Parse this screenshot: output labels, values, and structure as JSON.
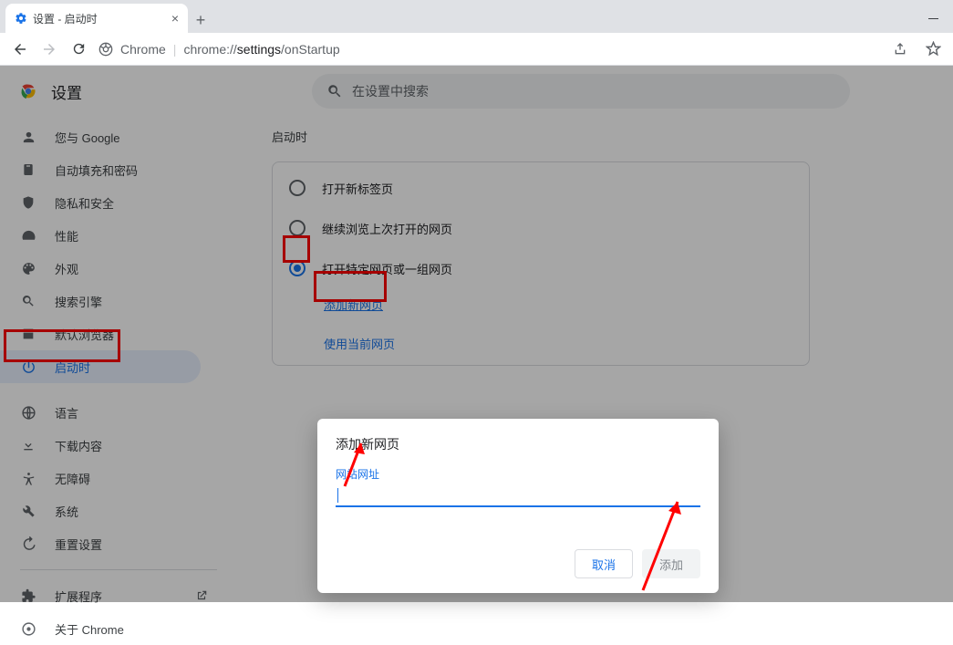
{
  "tab": {
    "title": "设置 - 启动时"
  },
  "omnibox": {
    "origin_label": "Chrome",
    "sep": " | ",
    "origin": "chrome://",
    "path_bold": "settings",
    "path_rest": "/onStartup"
  },
  "header": {
    "title": "设置"
  },
  "search": {
    "placeholder": "在设置中搜索"
  },
  "sidebar": {
    "items": [
      {
        "label": "您与 Google",
        "icon": "person"
      },
      {
        "label": "自动填充和密码",
        "icon": "clipboard"
      },
      {
        "label": "隐私和安全",
        "icon": "shield"
      },
      {
        "label": "性能",
        "icon": "speed"
      },
      {
        "label": "外观",
        "icon": "palette"
      },
      {
        "label": "搜索引擎",
        "icon": "search"
      },
      {
        "label": "默认浏览器",
        "icon": "browser"
      },
      {
        "label": "启动时",
        "icon": "power",
        "active": true
      },
      {
        "label": "语言",
        "icon": "globe"
      },
      {
        "label": "下载内容",
        "icon": "download"
      },
      {
        "label": "无障碍",
        "icon": "accessibility"
      },
      {
        "label": "系统",
        "icon": "wrench"
      },
      {
        "label": "重置设置",
        "icon": "restore"
      }
    ],
    "footer": [
      {
        "label": "扩展程序",
        "icon": "extension"
      },
      {
        "label": "关于 Chrome",
        "icon": "chrome"
      }
    ]
  },
  "panel": {
    "section_title": "启动时",
    "radios": [
      {
        "label": "打开新标签页",
        "checked": false
      },
      {
        "label": "继续浏览上次打开的网页",
        "checked": false
      },
      {
        "label": "打开特定网页或一组网页",
        "checked": true
      }
    ],
    "links": {
      "add": "添加新网页",
      "use_current": "使用当前网页"
    }
  },
  "dialog": {
    "title": "添加新网页",
    "field_label": "网站网址",
    "value": "",
    "cancel": "取消",
    "add": "添加"
  }
}
